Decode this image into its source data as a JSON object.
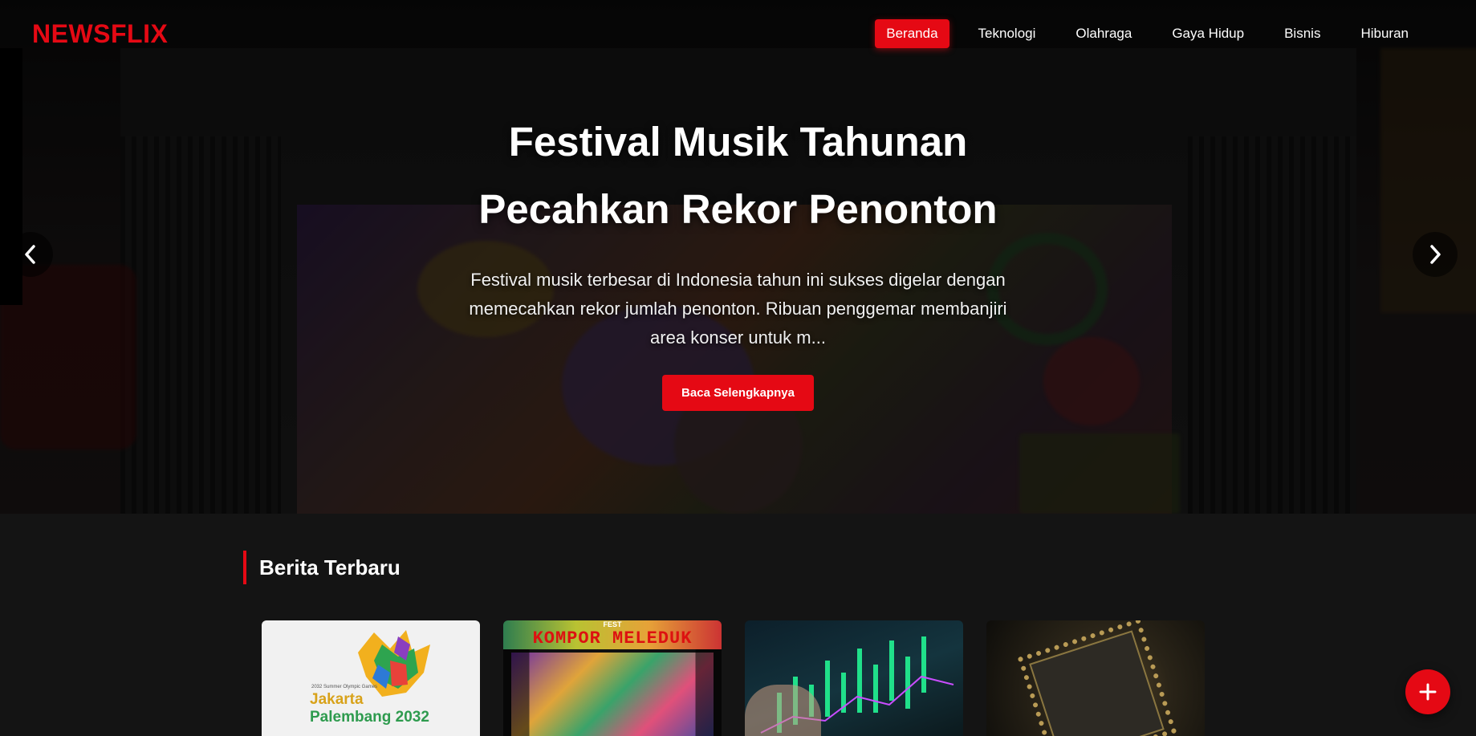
{
  "brand": {
    "logo": "NEWSFLIX",
    "accent_color": "#e50914"
  },
  "nav": {
    "items": [
      {
        "label": "Beranda",
        "active": true
      },
      {
        "label": "Teknologi",
        "active": false
      },
      {
        "label": "Olahraga",
        "active": false
      },
      {
        "label": "Gaya Hidup",
        "active": false
      },
      {
        "label": "Bisnis",
        "active": false
      },
      {
        "label": "Hiburan",
        "active": false
      }
    ]
  },
  "hero": {
    "title_line1": "Festival Musik Tahunan",
    "title_line2": "Pecahkan Rekor Penonton",
    "description": "Festival musik terbesar di Indonesia tahun ini sukses digelar dengan memecahkan rekor jumlah penonton. Ribuan penggemar membanjiri area konser untuk m...",
    "button_label": "Baca Selengkapnya",
    "prev_icon": "chevron-left-icon",
    "next_icon": "chevron-right-icon"
  },
  "latest": {
    "section_title": "Berita Terbaru",
    "cards": [
      {
        "image": "olympic-bid-logo",
        "image_text_small": "2032 Summer Olympic Games",
        "image_text_line1": "Jakarta",
        "image_text_line2": "Palembang 2032"
      },
      {
        "image": "festival-stage",
        "image_text_top": "FEST",
        "image_text_banner": "KOMPOR MELEDUK"
      },
      {
        "image": "stock-chart"
      },
      {
        "image": "microchip"
      }
    ]
  },
  "fab": {
    "icon": "plus-icon"
  }
}
